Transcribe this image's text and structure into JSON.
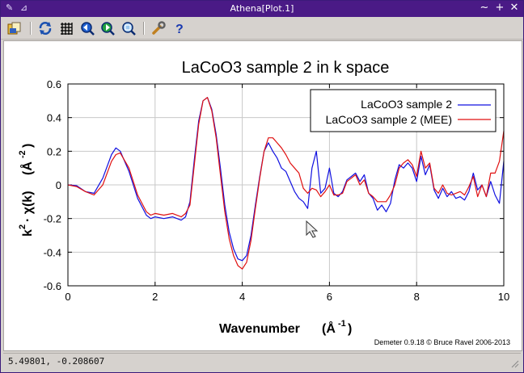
{
  "window": {
    "title": "Athena[Plot.1]"
  },
  "toolbar": {
    "buttons": [
      {
        "name": "open-file-icon"
      },
      {
        "name": "refresh-icon"
      },
      {
        "name": "grid-icon"
      },
      {
        "name": "zoom-back-icon"
      },
      {
        "name": "zoom-forward-icon"
      },
      {
        "name": "zoom-icon"
      },
      {
        "name": "wrench-icon"
      },
      {
        "name": "help-icon"
      }
    ]
  },
  "status": {
    "coords": "5.49801, -0.208607"
  },
  "credit": "Demeter 0.9.18 © Bruce Ravel 2006-2013",
  "colors": {
    "series1": "#1010e0",
    "series2": "#e01010",
    "titlebar": "#4a1a86"
  },
  "chart_data": {
    "type": "line",
    "title": "LaCoO3 sample 2 in k space",
    "xlabel": "Wavenumber (Å-1)",
    "ylabel": "k2 · χ(k) (Å-2)",
    "xlabel_main": "Wavenumber",
    "xlabel_unit": "(Å",
    "xlabel_unit_sup": "-1",
    "xlabel_unit_close": ")",
    "ylabel_k": "k",
    "ylabel_k_sup": "2",
    "ylabel_chi": "· χ(k)",
    "ylabel_unit": "(Å",
    "ylabel_unit_sup": "-2",
    "ylabel_unit_close": ")",
    "xlim": [
      0,
      10
    ],
    "ylim": [
      -0.6,
      0.6
    ],
    "xticks": [
      "0",
      "2",
      "4",
      "6",
      "8",
      "10"
    ],
    "xtick_values": [
      0,
      2,
      4,
      6,
      8,
      10
    ],
    "yticks": [
      "0.6",
      "0.4",
      "0.2",
      "0",
      "-0.2",
      "-0.4",
      "-0.6"
    ],
    "ytick_values": [
      0.6,
      0.4,
      0.2,
      0,
      -0.2,
      -0.4,
      -0.6
    ],
    "grid": true,
    "legend_position": "top-right",
    "series": [
      {
        "name": "LaCoO3 sample 2",
        "color": "#1010e0",
        "x": [
          0,
          0.2,
          0.4,
          0.6,
          0.8,
          1.0,
          1.1,
          1.2,
          1.4,
          1.6,
          1.8,
          1.9,
          2.0,
          2.2,
          2.4,
          2.6,
          2.7,
          2.8,
          2.9,
          3.0,
          3.1,
          3.2,
          3.3,
          3.4,
          3.5,
          3.6,
          3.7,
          3.8,
          3.9,
          4.0,
          4.1,
          4.2,
          4.3,
          4.4,
          4.5,
          4.6,
          4.7,
          4.8,
          4.9,
          5.0,
          5.1,
          5.2,
          5.3,
          5.4,
          5.5,
          5.6,
          5.7,
          5.8,
          5.9,
          6.0,
          6.1,
          6.2,
          6.3,
          6.4,
          6.5,
          6.6,
          6.7,
          6.8,
          6.9,
          7.0,
          7.1,
          7.2,
          7.3,
          7.4,
          7.5,
          7.6,
          7.7,
          7.8,
          7.9,
          8.0,
          8.1,
          8.2,
          8.3,
          8.4,
          8.5,
          8.6,
          8.7,
          8.8,
          8.9,
          9.0,
          9.1,
          9.2,
          9.3,
          9.4,
          9.5,
          9.6,
          9.7,
          9.8,
          9.9,
          10.0
        ],
        "y": [
          0.0,
          -0.005,
          -0.04,
          -0.05,
          0.04,
          0.18,
          0.22,
          0.2,
          0.08,
          -0.08,
          -0.18,
          -0.2,
          -0.19,
          -0.2,
          -0.19,
          -0.21,
          -0.19,
          -0.1,
          0.15,
          0.38,
          0.5,
          0.52,
          0.45,
          0.3,
          0.1,
          -0.12,
          -0.28,
          -0.38,
          -0.44,
          -0.45,
          -0.42,
          -0.3,
          -0.12,
          0.05,
          0.2,
          0.25,
          0.2,
          0.16,
          0.1,
          0.08,
          0.02,
          -0.04,
          -0.08,
          -0.1,
          -0.14,
          0.1,
          0.2,
          -0.05,
          -0.02,
          0.1,
          -0.05,
          -0.07,
          -0.04,
          0.03,
          0.05,
          0.07,
          0.02,
          0.06,
          -0.05,
          -0.08,
          -0.15,
          -0.12,
          -0.16,
          -0.11,
          0.03,
          0.12,
          0.1,
          0.13,
          0.1,
          0.02,
          0.17,
          0.06,
          0.12,
          -0.03,
          -0.08,
          -0.02,
          -0.07,
          -0.04,
          -0.08,
          -0.07,
          -0.09,
          -0.04,
          0.07,
          -0.03,
          0.0,
          -0.07,
          0.02,
          -0.06,
          -0.11,
          0.14
        ]
      },
      {
        "name": "LaCoO3 sample 2 (MEE)",
        "color": "#e01010",
        "x": [
          0,
          0.2,
          0.4,
          0.6,
          0.8,
          1.0,
          1.1,
          1.2,
          1.4,
          1.6,
          1.8,
          1.9,
          2.0,
          2.2,
          2.4,
          2.6,
          2.7,
          2.8,
          2.9,
          3.0,
          3.1,
          3.2,
          3.3,
          3.4,
          3.5,
          3.6,
          3.7,
          3.8,
          3.9,
          4.0,
          4.1,
          4.2,
          4.3,
          4.4,
          4.5,
          4.6,
          4.7,
          4.8,
          4.9,
          5.0,
          5.1,
          5.2,
          5.3,
          5.4,
          5.5,
          5.6,
          5.7,
          5.8,
          5.9,
          6.0,
          6.1,
          6.2,
          6.3,
          6.4,
          6.5,
          6.6,
          6.7,
          6.8,
          6.9,
          7.0,
          7.1,
          7.2,
          7.3,
          7.4,
          7.5,
          7.6,
          7.7,
          7.8,
          7.9,
          8.0,
          8.1,
          8.2,
          8.3,
          8.4,
          8.5,
          8.6,
          8.7,
          8.8,
          8.9,
          9.0,
          9.1,
          9.2,
          9.3,
          9.4,
          9.5,
          9.6,
          9.7,
          9.8,
          9.9,
          10.0
        ],
        "y": [
          0.0,
          -0.01,
          -0.04,
          -0.06,
          0.0,
          0.14,
          0.18,
          0.19,
          0.1,
          -0.06,
          -0.16,
          -0.18,
          -0.17,
          -0.18,
          -0.17,
          -0.19,
          -0.17,
          -0.12,
          0.12,
          0.36,
          0.5,
          0.52,
          0.44,
          0.28,
          0.06,
          -0.16,
          -0.32,
          -0.42,
          -0.48,
          -0.5,
          -0.46,
          -0.33,
          -0.14,
          0.04,
          0.2,
          0.28,
          0.28,
          0.25,
          0.22,
          0.18,
          0.13,
          0.1,
          0.07,
          -0.02,
          -0.05,
          -0.02,
          -0.03,
          -0.07,
          -0.04,
          0.0,
          -0.06,
          -0.06,
          -0.05,
          0.02,
          0.04,
          0.06,
          0.0,
          0.03,
          -0.05,
          -0.07,
          -0.1,
          -0.1,
          -0.1,
          -0.06,
          0.0,
          0.1,
          0.13,
          0.15,
          0.12,
          0.05,
          0.2,
          0.1,
          0.13,
          -0.02,
          -0.05,
          0.0,
          -0.05,
          -0.06,
          -0.05,
          -0.04,
          -0.06,
          -0.01,
          0.05,
          -0.07,
          0.0,
          -0.07,
          0.07,
          0.07,
          0.14,
          0.32
        ]
      }
    ]
  }
}
